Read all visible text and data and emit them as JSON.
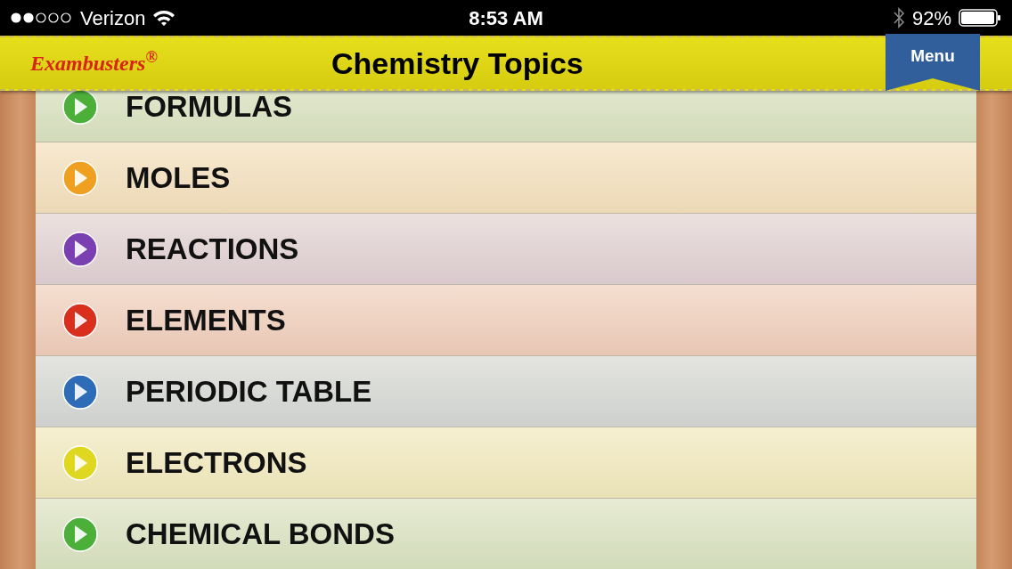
{
  "status_bar": {
    "carrier": "Verizon",
    "time": "8:53 AM",
    "battery": "92%"
  },
  "header": {
    "logo": "Exambusters$^{®}$",
    "title": "Chemistry Topics",
    "menu_button": "Menu"
  },
  "topics": [
    {
      "label": "FORMULAS",
      "color": "#4caf3a"
    },
    {
      "label": "MOLES",
      "color": "#f0a020"
    },
    {
      "label": "REACTIONS",
      "color": "#7a3fb0"
    },
    {
      "label": "ELEMENTS",
      "color": "#d8301c"
    },
    {
      "label": "PERIODIC TABLE",
      "color": "#2f6cb8"
    },
    {
      "label": "ELECTRONS",
      "color": "#e0d820"
    },
    {
      "label": "CHEMICAL BONDS",
      "color": "#4caf3a"
    }
  ]
}
